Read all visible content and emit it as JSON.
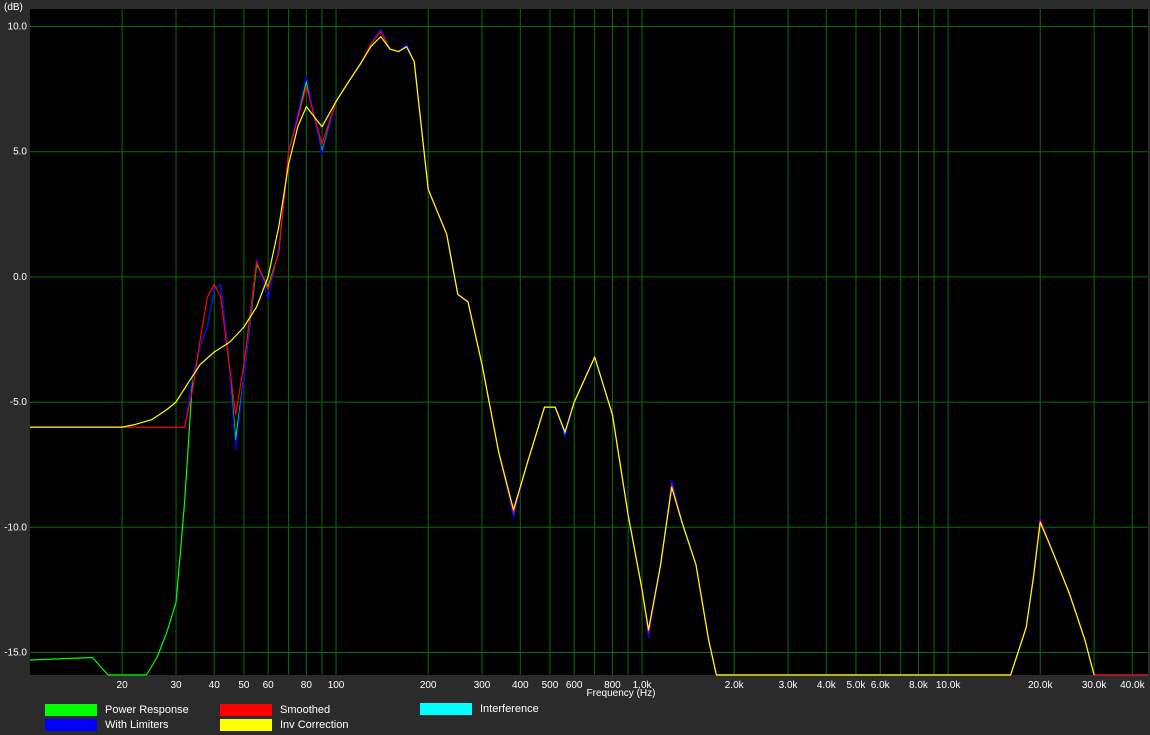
{
  "chart_data": {
    "type": "line",
    "ylabel": "(dB)",
    "xlabel": "Frequency (Hz)",
    "x_scale": "log",
    "xlim": [
      10,
      45000
    ],
    "ylim": [
      -15.9,
      10.7
    ],
    "grid": true,
    "y_ticks": [
      10,
      5,
      0,
      -5,
      -10,
      -15
    ],
    "y_tick_labels": [
      "10.0",
      "5.0",
      "0.0",
      "-5.0",
      "-10.0",
      "-15.0"
    ],
    "x_ticks": [
      20,
      30,
      40,
      50,
      60,
      80,
      100,
      200,
      300,
      400,
      500,
      600,
      800,
      1000,
      2000,
      3000,
      4000,
      5000,
      6000,
      8000,
      10000,
      20000,
      30000,
      40000
    ],
    "x_tick_labels": [
      "20",
      "30",
      "40",
      "50",
      "60",
      "80",
      "100",
      "200",
      "300",
      "400",
      "500",
      "600",
      "800",
      "1.0k",
      "2.0k",
      "3.0k",
      "4.0k",
      "5.0k",
      "6.0k",
      "8.0k",
      "10.0k",
      "20.0k",
      "30.0k",
      "40.0k"
    ],
    "legend_placement": "bottom",
    "colors": {
      "background": "#000000",
      "frame": "#2b2b2b",
      "grid": "#0b6e0b",
      "power": "#00ff00",
      "limiters": "#0000ff",
      "smoothed": "#ff0000",
      "inv": "#ffff00",
      "interference": "#00ffff"
    },
    "series": [
      {
        "name": "Power Response",
        "color": "#00ff00",
        "x": [
          10,
          16,
          18,
          20,
          22,
          24,
          26,
          28,
          30,
          31,
          32,
          33,
          34,
          36,
          38,
          40,
          42,
          44,
          47,
          50,
          55,
          60,
          65,
          70,
          80,
          90,
          100,
          110,
          120,
          130,
          140,
          150,
          160,
          170,
          180,
          200,
          230,
          250,
          270,
          300,
          340,
          380,
          420,
          480,
          520,
          560,
          600,
          700,
          800,
          900,
          1000,
          1050,
          1150,
          1250,
          1350,
          1500,
          1650,
          1750,
          16000,
          18000,
          19000,
          20000,
          22000,
          25000,
          28000,
          30000,
          45000
        ],
        "y": [
          -15.3,
          -15.2,
          -15.9,
          -15.9,
          -15.9,
          -15.9,
          -15.2,
          -14.2,
          -13.0,
          -11.0,
          -9.0,
          -6.5,
          -4.0,
          -2.8,
          -2.0,
          -0.5,
          -0.3,
          -2.5,
          -6.5,
          -4.0,
          0.5,
          -0.4,
          1.0,
          5.0,
          7.8,
          5.0,
          7.0,
          7.8,
          8.5,
          9.3,
          9.9,
          9.1,
          9.0,
          9.2,
          8.6,
          3.5,
          1.7,
          -0.7,
          -1.0,
          -3.5,
          -7.0,
          -9.5,
          -7.5,
          -5.2,
          -5.2,
          -6.3,
          -5.0,
          -3.2,
          -5.5,
          -9.5,
          -12.5,
          -14.3,
          -11.5,
          -8.2,
          -9.8,
          -11.5,
          -14.5,
          -15.9,
          -15.9,
          -14.0,
          -12.0,
          -9.7,
          -11.0,
          -12.7,
          -14.5,
          -15.9,
          -15.9
        ]
      },
      {
        "name": "With Limiters",
        "color": "#0000ff",
        "x": [
          10,
          30,
          32,
          34,
          36,
          38,
          40,
          42,
          44,
          47,
          50,
          55,
          60,
          65,
          70,
          80,
          90,
          100,
          110,
          120,
          130,
          140,
          150,
          160,
          170,
          180,
          200,
          230,
          250,
          270,
          300,
          340,
          380,
          420,
          480,
          520,
          560,
          600,
          700,
          800,
          900,
          1000,
          1050,
          1150,
          1250,
          1350,
          1500,
          1650,
          1750,
          16000,
          18000,
          19000,
          20000,
          22000,
          25000,
          28000,
          30000,
          45000
        ],
        "y": [
          -6.0,
          -6.0,
          -6.0,
          -4.0,
          -2.8,
          -2.0,
          -0.5,
          -0.3,
          -2.5,
          -6.9,
          -4.0,
          0.7,
          -0.9,
          1.2,
          5.0,
          8.0,
          4.9,
          7.0,
          7.8,
          8.5,
          9.3,
          9.9,
          9.1,
          9.0,
          9.3,
          8.6,
          3.5,
          1.7,
          -0.7,
          -1.0,
          -3.5,
          -7.0,
          -9.6,
          -7.5,
          -5.2,
          -5.2,
          -6.4,
          -5.0,
          -3.2,
          -5.5,
          -9.5,
          -12.5,
          -14.4,
          -11.5,
          -8.1,
          -9.8,
          -11.5,
          -14.5,
          -15.9,
          -15.9,
          -14.0,
          -12.0,
          -9.6,
          -11.0,
          -12.7,
          -14.5,
          -15.9,
          -15.9
        ]
      },
      {
        "name": "Smoothed",
        "color": "#ff0000",
        "x": [
          10,
          30,
          32,
          34,
          36,
          38,
          40,
          42,
          44,
          47,
          50,
          55,
          60,
          65,
          70,
          80,
          90,
          100,
          110,
          120,
          130,
          140,
          150,
          160,
          170,
          180,
          200,
          230,
          250,
          270,
          300,
          340,
          380,
          420,
          480,
          520,
          560,
          600,
          700,
          800,
          900,
          1000,
          1050,
          1150,
          1250,
          1350,
          1500,
          1650,
          1750,
          16000,
          18000,
          19000,
          20000,
          22000,
          25000,
          28000,
          30000,
          45000
        ],
        "y": [
          -6.0,
          -6.0,
          -6.0,
          -4.5,
          -2.5,
          -0.8,
          -0.3,
          -0.8,
          -2.8,
          -5.5,
          -3.5,
          0.6,
          -0.5,
          1.0,
          5.0,
          7.6,
          5.3,
          7.0,
          7.8,
          8.5,
          9.3,
          9.8,
          9.1,
          9.0,
          9.2,
          8.6,
          3.5,
          1.7,
          -0.7,
          -1.0,
          -3.5,
          -7.0,
          -9.4,
          -7.5,
          -5.2,
          -5.2,
          -6.2,
          -5.0,
          -3.2,
          -5.5,
          -9.5,
          -12.5,
          -14.2,
          -11.5,
          -8.3,
          -9.8,
          -11.5,
          -14.5,
          -15.9,
          -15.9,
          -14.0,
          -12.0,
          -9.7,
          -11.0,
          -12.7,
          -14.5,
          -15.9,
          -15.9
        ]
      },
      {
        "name": "Inv Correction",
        "color": "#ffff00",
        "x": [
          10,
          20,
          22,
          25,
          28,
          30,
          33,
          36,
          40,
          45,
          50,
          55,
          60,
          65,
          70,
          75,
          80,
          90,
          100,
          110,
          120,
          130,
          140,
          150,
          160,
          170,
          180,
          200,
          230,
          250,
          270,
          300,
          340,
          380,
          420,
          480,
          520,
          560,
          600,
          700,
          800,
          900,
          1000,
          1050,
          1150,
          1250,
          1350,
          1500,
          1650,
          1750,
          16000,
          18000,
          19000,
          20000,
          22000,
          25000,
          28000,
          30000
        ],
        "y": [
          -6.0,
          -6.0,
          -5.9,
          -5.7,
          -5.3,
          -5.0,
          -4.2,
          -3.5,
          -3.0,
          -2.6,
          -2.0,
          -1.2,
          0.0,
          2.0,
          4.5,
          6.0,
          6.8,
          6.0,
          7.0,
          7.8,
          8.5,
          9.2,
          9.6,
          9.1,
          9.0,
          9.2,
          8.6,
          3.5,
          1.7,
          -0.7,
          -1.0,
          -3.5,
          -7.0,
          -9.3,
          -7.5,
          -5.2,
          -5.2,
          -6.2,
          -5.0,
          -3.2,
          -5.5,
          -9.5,
          -12.5,
          -14.1,
          -11.5,
          -8.4,
          -9.8,
          -11.5,
          -14.5,
          -15.9,
          -15.9,
          -14.0,
          -12.0,
          -9.8,
          -11.0,
          -12.7,
          -14.5,
          -15.9
        ]
      },
      {
        "name": "Interference",
        "color": "#00ffff",
        "x": [],
        "y": []
      }
    ]
  }
}
